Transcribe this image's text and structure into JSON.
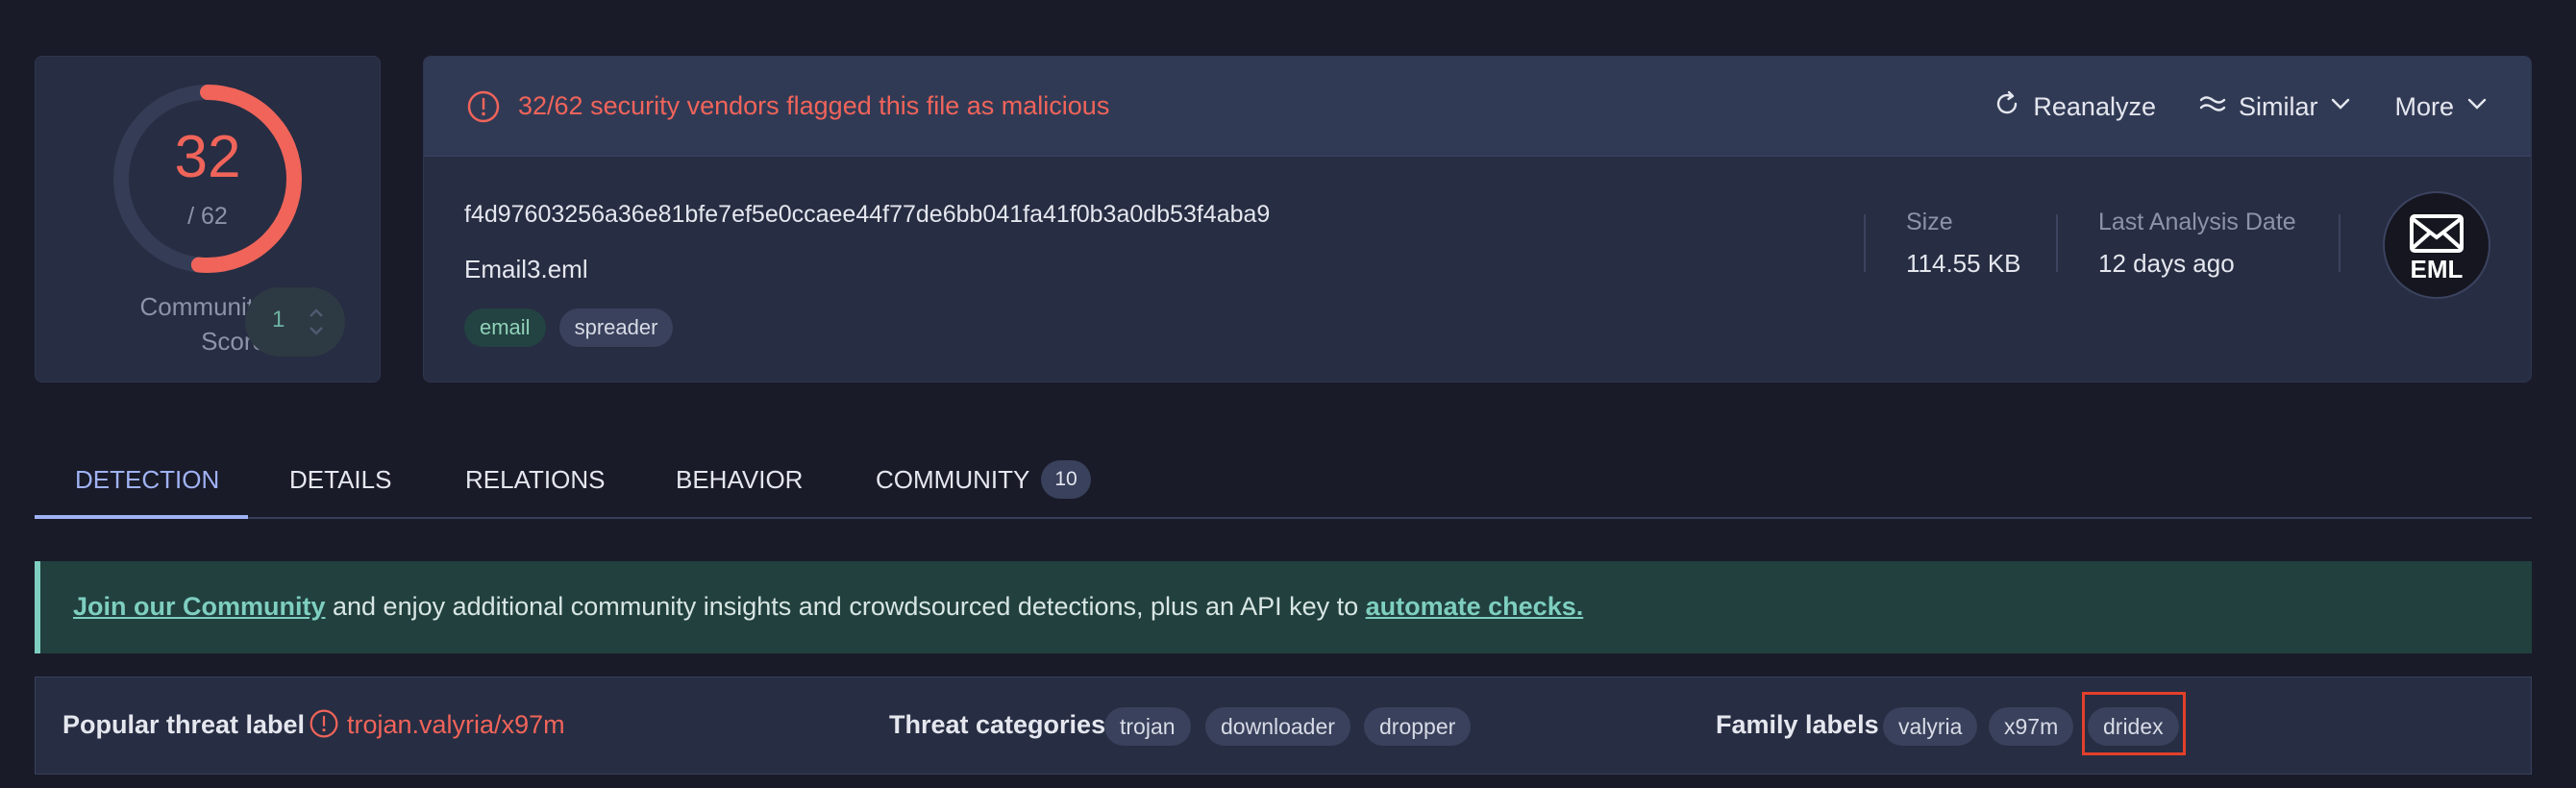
{
  "score": {
    "detections": "32",
    "total": "/ 62",
    "fraction_flagged": 0.516,
    "community_label": "Community Score",
    "community_value": "1"
  },
  "alert": {
    "text": "32/62 security vendors flagged this file as malicious",
    "icon": "alert-circle-icon",
    "color": "#f0645a"
  },
  "actions": {
    "reanalyze": "Reanalyze",
    "similar": "Similar",
    "more": "More"
  },
  "file": {
    "hash": "f4d97603256a36e81bfe7ef5e0ccaee44f77de6bb041fa41f0b3a0db53f4aba9",
    "name": "Email3.eml",
    "tags": [
      "email",
      "spreader"
    ],
    "size_label": "Size",
    "size_value": "114.55 KB",
    "date_label": "Last Analysis Date",
    "date_value": "12 days ago",
    "type_badge": "EML"
  },
  "tabs": [
    {
      "label": "DETECTION",
      "active": true
    },
    {
      "label": "DETAILS"
    },
    {
      "label": "RELATIONS"
    },
    {
      "label": "BEHAVIOR"
    },
    {
      "label": "COMMUNITY",
      "badge": "10"
    }
  ],
  "banner": {
    "link1": "Join our Community",
    "middle": " and enjoy additional community insights and crowdsourced detections, plus an API key to ",
    "link2": "automate checks."
  },
  "threat": {
    "popular_label": "Popular threat label",
    "popular_value": "trojan.valyria/x97m",
    "categories_label": "Threat categories",
    "categories": [
      "trojan",
      "downloader",
      "dropper"
    ],
    "family_label": "Family labels",
    "families": [
      "valyria",
      "x97m",
      "dridex"
    ]
  },
  "colors": {
    "accent_red": "#f0645a",
    "accent_blue": "#9fb2f3",
    "accent_teal": "#7ecfc0",
    "highlight": "#e2402b"
  }
}
